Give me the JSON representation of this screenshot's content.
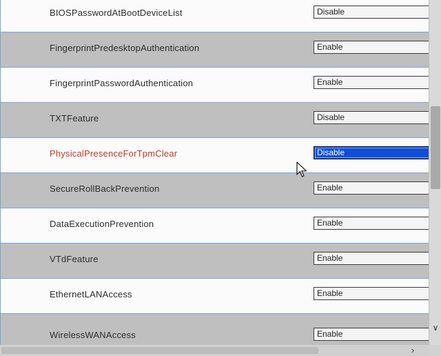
{
  "settings": {
    "rows": [
      {
        "label": "BIOSPasswordAtBootDeviceList",
        "value": "Disable"
      },
      {
        "label": "FingerprintPredesktopAuthentication",
        "value": "Enable"
      },
      {
        "label": "FingerprintPasswordAuthentication",
        "value": "Enable"
      },
      {
        "label": "TXTFeature",
        "value": "Disable"
      },
      {
        "label": "PhysicalPresenceForTpmClear",
        "value": "Disable"
      },
      {
        "label": "SecureRollBackPrevention",
        "value": "Enable"
      },
      {
        "label": "DataExecutionPrevention",
        "value": "Enable"
      },
      {
        "label": "VTdFeature",
        "value": "Enable"
      },
      {
        "label": "EthernetLANAccess",
        "value": "Enable"
      },
      {
        "label": "WirelessWANAccess",
        "value": "Enable"
      }
    ]
  },
  "icons": {
    "scroll_down": "chevron-down-icon",
    "scroll_right": "chevron-right-icon",
    "cursor": "mouse-pointer-icon"
  },
  "colors": {
    "grid_line": "#7f9fd6",
    "selected_bg": "#0f4fd8",
    "active_label": "#c0392b",
    "row_alt": "#bfbfbf"
  }
}
